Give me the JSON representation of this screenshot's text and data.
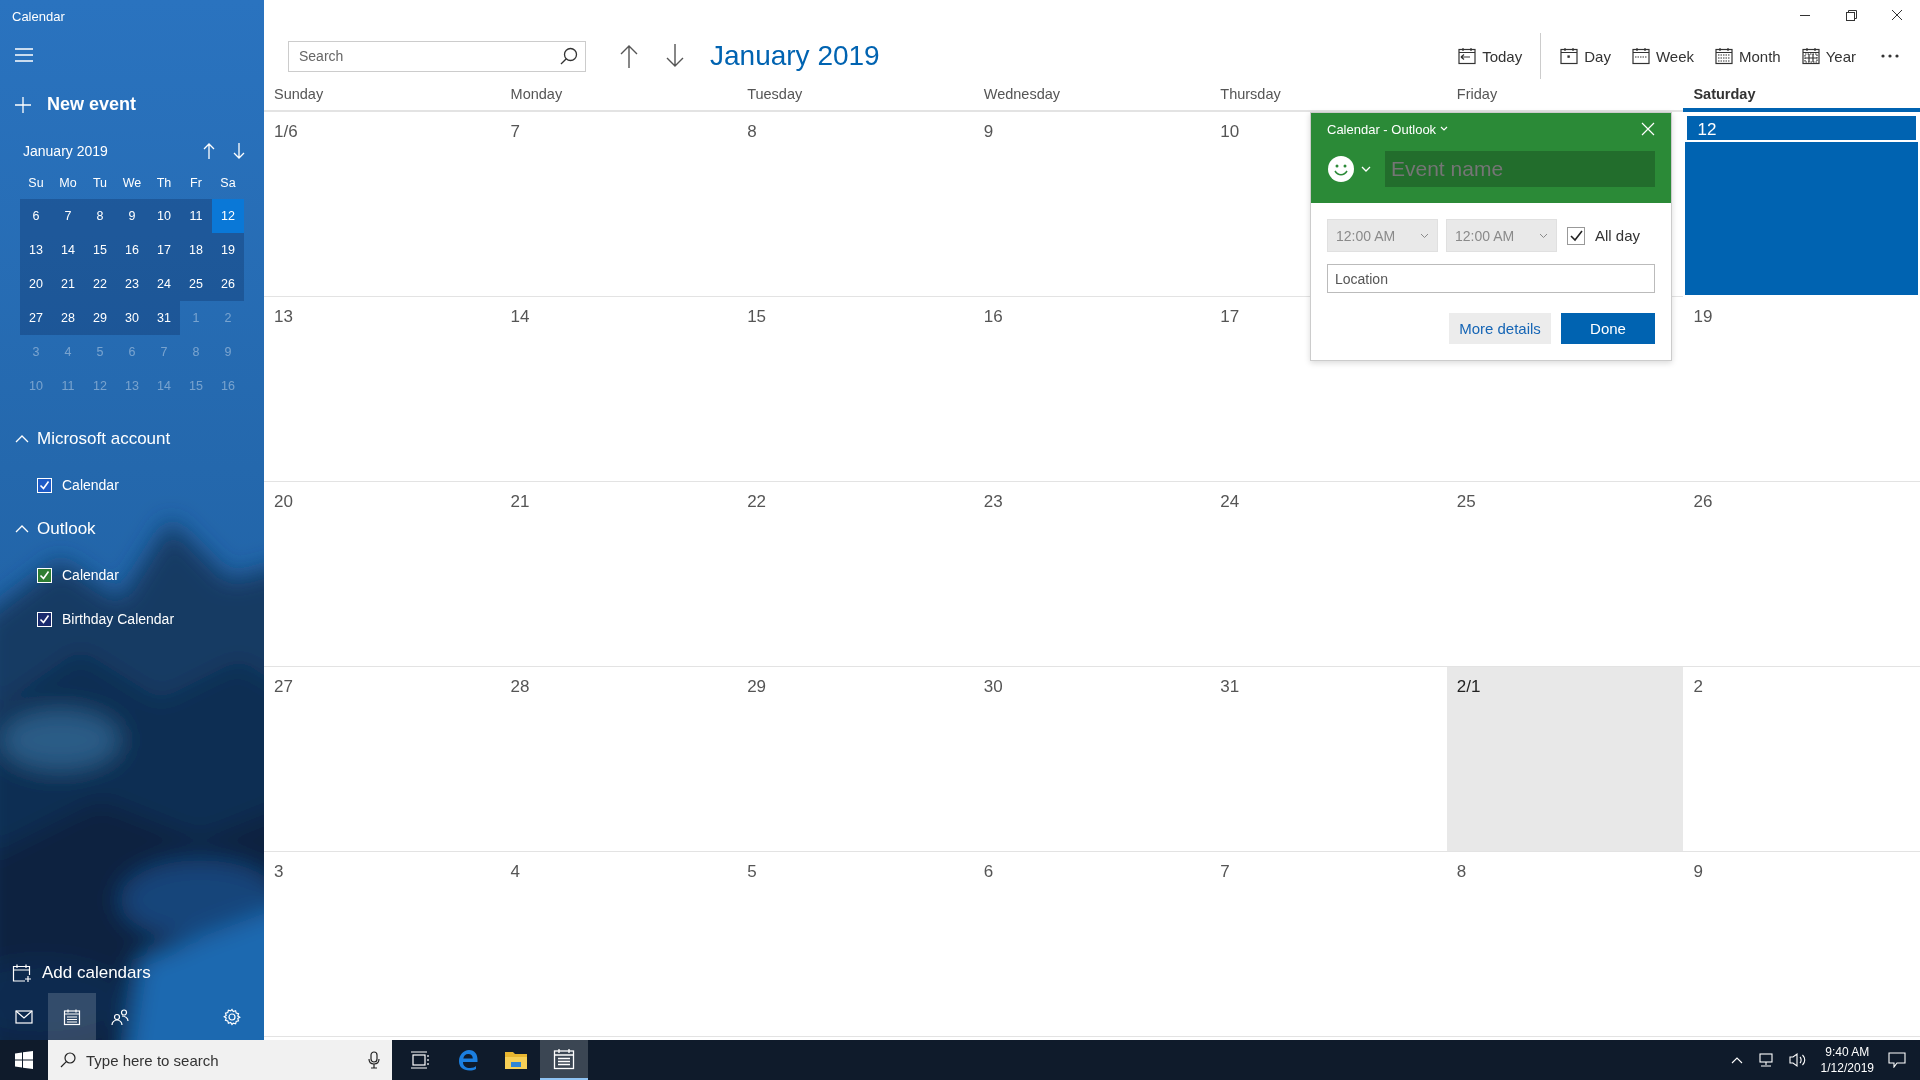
{
  "window": {
    "title": "Calendar"
  },
  "sidebar": {
    "new_event": "New event",
    "mini_calendar": {
      "title": "January 2019",
      "weekdays": [
        "Su",
        "Mo",
        "Tu",
        "We",
        "Th",
        "Fr",
        "Sa"
      ],
      "weeks": [
        [
          {
            "label": "6",
            "in_month": true,
            "selected": false
          },
          {
            "label": "7",
            "in_month": true,
            "selected": false
          },
          {
            "label": "8",
            "in_month": true,
            "selected": false
          },
          {
            "label": "9",
            "in_month": true,
            "selected": false
          },
          {
            "label": "10",
            "in_month": true,
            "selected": false
          },
          {
            "label": "11",
            "in_month": true,
            "selected": false
          },
          {
            "label": "12",
            "in_month": true,
            "selected": true
          }
        ],
        [
          {
            "label": "13",
            "in_month": true,
            "selected": false
          },
          {
            "label": "14",
            "in_month": true,
            "selected": false
          },
          {
            "label": "15",
            "in_month": true,
            "selected": false
          },
          {
            "label": "16",
            "in_month": true,
            "selected": false
          },
          {
            "label": "17",
            "in_month": true,
            "selected": false
          },
          {
            "label": "18",
            "in_month": true,
            "selected": false
          },
          {
            "label": "19",
            "in_month": true,
            "selected": false
          }
        ],
        [
          {
            "label": "20",
            "in_month": true,
            "selected": false
          },
          {
            "label": "21",
            "in_month": true,
            "selected": false
          },
          {
            "label": "22",
            "in_month": true,
            "selected": false
          },
          {
            "label": "23",
            "in_month": true,
            "selected": false
          },
          {
            "label": "24",
            "in_month": true,
            "selected": false
          },
          {
            "label": "25",
            "in_month": true,
            "selected": false
          },
          {
            "label": "26",
            "in_month": true,
            "selected": false
          }
        ],
        [
          {
            "label": "27",
            "in_month": true,
            "selected": false
          },
          {
            "label": "28",
            "in_month": true,
            "selected": false
          },
          {
            "label": "29",
            "in_month": true,
            "selected": false
          },
          {
            "label": "30",
            "in_month": true,
            "selected": false
          },
          {
            "label": "31",
            "in_month": true,
            "selected": false
          },
          {
            "label": "1",
            "in_month": false,
            "selected": false
          },
          {
            "label": "2",
            "in_month": false,
            "selected": false
          }
        ],
        [
          {
            "label": "3",
            "in_month": false,
            "selected": false
          },
          {
            "label": "4",
            "in_month": false,
            "selected": false
          },
          {
            "label": "5",
            "in_month": false,
            "selected": false
          },
          {
            "label": "6",
            "in_month": false,
            "selected": false
          },
          {
            "label": "7",
            "in_month": false,
            "selected": false
          },
          {
            "label": "8",
            "in_month": false,
            "selected": false
          },
          {
            "label": "9",
            "in_month": false,
            "selected": false
          }
        ],
        [
          {
            "label": "10",
            "in_month": false,
            "selected": false
          },
          {
            "label": "11",
            "in_month": false,
            "selected": false
          },
          {
            "label": "12",
            "in_month": false,
            "selected": false
          },
          {
            "label": "13",
            "in_month": false,
            "selected": false
          },
          {
            "label": "14",
            "in_month": false,
            "selected": false
          },
          {
            "label": "15",
            "in_month": false,
            "selected": false
          },
          {
            "label": "16",
            "in_month": false,
            "selected": false
          }
        ]
      ]
    },
    "groups": [
      {
        "name": "Microsoft account",
        "expanded": true,
        "calendars": [
          {
            "name": "Calendar",
            "checked": true,
            "color": "#1e5bc6"
          }
        ]
      },
      {
        "name": "Outlook",
        "expanded": true,
        "calendars": [
          {
            "name": "Calendar",
            "checked": true,
            "color": "#2e7d32"
          },
          {
            "name": "Birthday Calendar",
            "checked": true,
            "color": "#1a2a6e"
          }
        ]
      }
    ],
    "add_calendars": "Add calendars",
    "nav": [
      {
        "kind": "mail",
        "selected": false
      },
      {
        "kind": "calendar",
        "selected": true
      },
      {
        "kind": "people",
        "selected": false
      },
      {
        "kind": "settings",
        "selected": false
      }
    ]
  },
  "toolbar": {
    "search": {
      "placeholder": "Search"
    },
    "title": "January 2019",
    "views": [
      {
        "kind": "today",
        "label": "Today"
      },
      {
        "kind": "day",
        "label": "Day"
      },
      {
        "kind": "week",
        "label": "Week"
      },
      {
        "kind": "month",
        "label": "Month"
      },
      {
        "kind": "year",
        "label": "Year"
      }
    ]
  },
  "month": {
    "weekdays": [
      {
        "label": "Sunday",
        "selected": false
      },
      {
        "label": "Monday",
        "selected": false
      },
      {
        "label": "Tuesday",
        "selected": false
      },
      {
        "label": "Wednesday",
        "selected": false
      },
      {
        "label": "Thursday",
        "selected": false
      },
      {
        "label": "Friday",
        "selected": false
      },
      {
        "label": "Saturday",
        "selected": true
      }
    ],
    "weeks": [
      [
        {
          "label": "1/6",
          "selected": false,
          "shaded": false
        },
        {
          "label": "7",
          "selected": false,
          "shaded": false
        },
        {
          "label": "8",
          "selected": false,
          "shaded": false
        },
        {
          "label": "9",
          "selected": false,
          "shaded": false
        },
        {
          "label": "10",
          "selected": false,
          "shaded": false
        },
        {
          "selected": false,
          "shaded": false
        },
        {
          "label": "12",
          "selected": true,
          "shaded": false
        }
      ],
      [
        {
          "label": "13",
          "selected": false,
          "shaded": false
        },
        {
          "label": "14",
          "selected": false,
          "shaded": false
        },
        {
          "label": "15",
          "selected": false,
          "shaded": false
        },
        {
          "label": "16",
          "selected": false,
          "shaded": false
        },
        {
          "label": "17",
          "selected": false,
          "shaded": false
        },
        {
          "selected": false,
          "shaded": false
        },
        {
          "label": "19",
          "selected": false,
          "shaded": false
        }
      ],
      [
        {
          "label": "20",
          "selected": false,
          "shaded": false
        },
        {
          "label": "21",
          "selected": false,
          "shaded": false
        },
        {
          "label": "22",
          "selected": false,
          "shaded": false
        },
        {
          "label": "23",
          "selected": false,
          "shaded": false
        },
        {
          "label": "24",
          "selected": false,
          "shaded": false
        },
        {
          "label": "25",
          "selected": false,
          "shaded": false
        },
        {
          "label": "26",
          "selected": false,
          "shaded": false
        }
      ],
      [
        {
          "label": "27",
          "selected": false,
          "shaded": false
        },
        {
          "label": "28",
          "selected": false,
          "shaded": false
        },
        {
          "label": "29",
          "selected": false,
          "shaded": false
        },
        {
          "label": "30",
          "selected": false,
          "shaded": false
        },
        {
          "label": "31",
          "selected": false,
          "shaded": false
        },
        {
          "label": "2/1",
          "selected": false,
          "shaded": true
        },
        {
          "label": "2",
          "selected": false,
          "shaded": false
        }
      ],
      [
        {
          "label": "3",
          "selected": false,
          "shaded": false
        },
        {
          "label": "4",
          "selected": false,
          "shaded": false
        },
        {
          "label": "5",
          "selected": false,
          "shaded": false
        },
        {
          "label": "6",
          "selected": false,
          "shaded": false
        },
        {
          "label": "7",
          "selected": false,
          "shaded": false
        },
        {
          "label": "8",
          "selected": false,
          "shaded": false
        },
        {
          "label": "9",
          "selected": false,
          "shaded": false
        }
      ]
    ]
  },
  "popup": {
    "calendar": "Calendar - Outlook",
    "event_name": {
      "placeholder": "Event name"
    },
    "start_time": {
      "value": "12:00 AM",
      "disabled": true
    },
    "end_time": {
      "value": "12:00 AM",
      "disabled": true
    },
    "all_day": {
      "label": "All day",
      "checked": true
    },
    "location": {
      "placeholder": "Location"
    },
    "buttons": [
      {
        "kind": "secondary",
        "label": "More details"
      },
      {
        "kind": "primary",
        "label": "Done"
      }
    ]
  },
  "taskbar": {
    "search": {
      "placeholder": "Type here to search"
    },
    "apps": [
      {
        "kind": "task-view",
        "active": false
      },
      {
        "kind": "browser",
        "active": false
      },
      {
        "kind": "folder",
        "active": false
      },
      {
        "kind": "calendar",
        "active": true
      }
    ],
    "clock": {
      "time": "9:40 AM",
      "date": "1/12/2019"
    }
  }
}
